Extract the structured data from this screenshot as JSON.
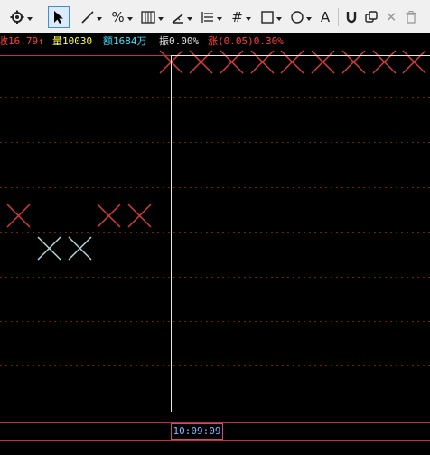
{
  "toolbar": {
    "tools": [
      {
        "name": "settings",
        "icon": "gear-icon"
      },
      {
        "name": "select",
        "icon": "cursor-arrow-icon"
      },
      {
        "name": "line",
        "icon": "line-icon"
      },
      {
        "name": "percent",
        "icon": "percent-icon",
        "glyph": "%"
      },
      {
        "name": "bars",
        "icon": "bars-grid-icon"
      },
      {
        "name": "angle",
        "icon": "angle-icon"
      },
      {
        "name": "list",
        "icon": "list-icon"
      },
      {
        "name": "grid",
        "icon": "hash-grid-icon",
        "glyph": "#"
      },
      {
        "name": "rectangle",
        "icon": "rectangle-icon"
      },
      {
        "name": "ellipse",
        "icon": "circle-icon"
      },
      {
        "name": "text",
        "icon": "text-a-icon",
        "glyph": "A"
      },
      {
        "name": "magnet",
        "icon": "magnet-icon"
      },
      {
        "name": "copy",
        "icon": "copy-icon"
      },
      {
        "name": "delete",
        "icon": "close-icon",
        "glyph": "✕"
      },
      {
        "name": "trash",
        "icon": "trash-icon"
      }
    ]
  },
  "infobar": {
    "price": "收16.79↑",
    "volume": "量10030",
    "amount": "额1684万",
    "amplitude": "振0.00%",
    "change": "涨(0.05)0.30%",
    "colors": {
      "price": "#ff4040",
      "volume": "#ffff40",
      "amount": "#40e0ff",
      "amplitude": "#e0e0e0",
      "change": "#ff4040"
    }
  },
  "crosshair": {
    "time": "10:09:09"
  },
  "colors": {
    "up_marker": "#e03c3c",
    "down_marker": "#b8e0e0",
    "grid": "#6e1e1e",
    "frame": "#c0304a"
  }
}
